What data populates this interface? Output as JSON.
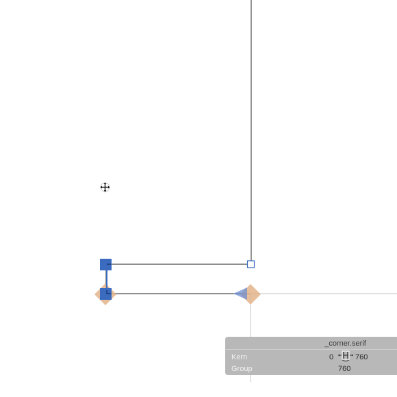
{
  "colors": {
    "outline": "#4a4a4a",
    "metric_line": "#c4c4c4",
    "node_selected": "#3a6bbf",
    "anchor": "#e3b48b",
    "panel_bg": "#b8b8b8"
  },
  "info_panel": {
    "glyph_name": "_corner.serif",
    "kern_label": "Kern",
    "kern_left_value": "0",
    "kern_right_value": "760",
    "group_label": "Group",
    "group_value": "760"
  },
  "icons": {
    "cursor": "move-cursor-icon",
    "kern_glyph": "kerning-glyph-icon"
  }
}
